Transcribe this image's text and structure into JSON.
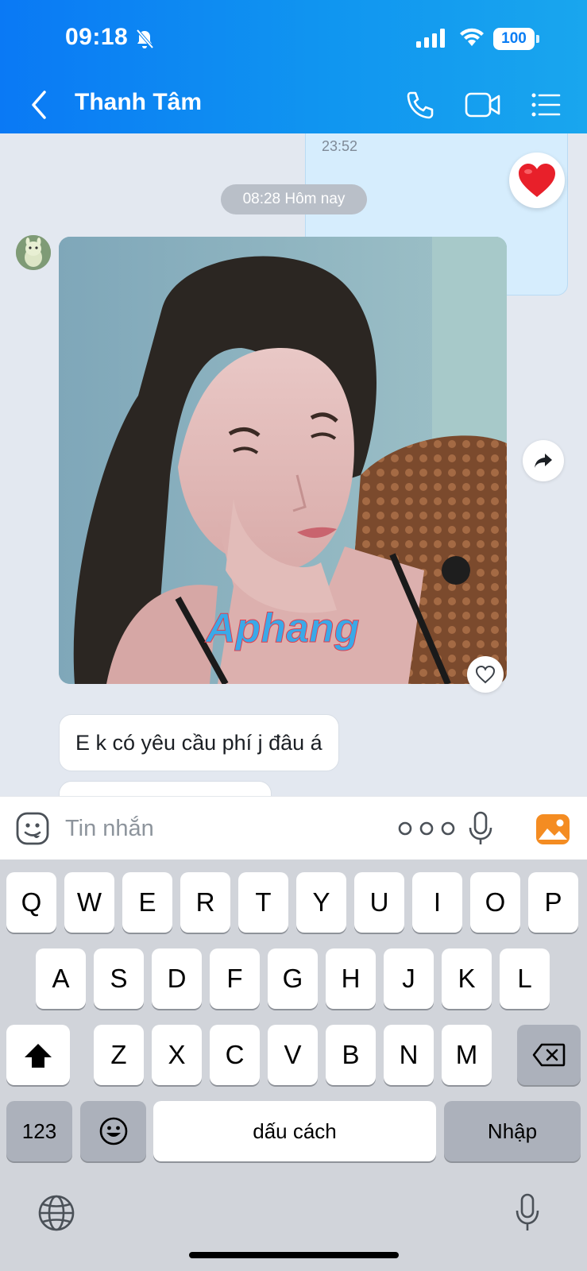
{
  "status_bar": {
    "time": "09:18",
    "battery": "100"
  },
  "header": {
    "title": "Thanh Tâm"
  },
  "chat": {
    "previous_message_time": "23:52",
    "date_separator": "08:28 Hôm nay",
    "photo_watermark": "Aphang",
    "messages": [
      {
        "text": "E k có yêu cầu phí j đâu á"
      }
    ]
  },
  "input": {
    "placeholder": "Tin nhắn",
    "value": ""
  },
  "keyboard": {
    "row1": [
      "Q",
      "W",
      "E",
      "R",
      "T",
      "Y",
      "U",
      "I",
      "O",
      "P"
    ],
    "row2": [
      "A",
      "S",
      "D",
      "F",
      "G",
      "H",
      "J",
      "K",
      "L"
    ],
    "row3": [
      "Z",
      "X",
      "C",
      "V",
      "B",
      "N",
      "M"
    ],
    "numbers_key": "123",
    "space_key": "dấu cách",
    "return_key": "Nhập"
  },
  "colors": {
    "header_start": "#0a79f5",
    "header_end": "#19a6ee",
    "image_button": "#f48c22",
    "heart": "#e8202a"
  },
  "icons": [
    "bell-off-icon",
    "signal-icon",
    "wifi-icon",
    "battery-icon",
    "back-icon",
    "phone-icon",
    "video-icon",
    "menu-icon",
    "heart-icon",
    "share-icon",
    "like-icon",
    "emoji-icon",
    "more-icon",
    "mic-icon",
    "image-icon",
    "shift-icon",
    "backspace-icon",
    "emoji-keyboard-icon",
    "globe-icon",
    "dictation-icon"
  ]
}
